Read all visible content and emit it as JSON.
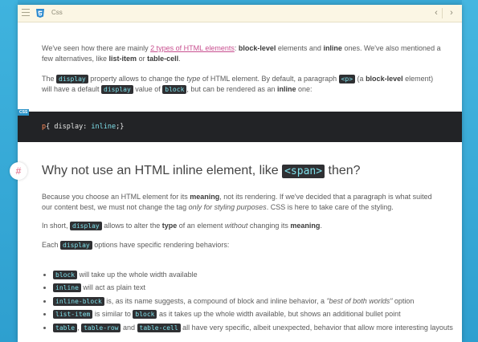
{
  "topbar": {
    "title": "Css"
  },
  "intro": {
    "t1": "We've seen how there are mainly ",
    "link": "2 types of HTML elements",
    "t2": ": ",
    "b1": "block-level",
    "t3": " elements and ",
    "b2": "inline",
    "t4": " ones. We've also mentioned a few alternatives, like ",
    "b3": "list-item",
    "t5": " or ",
    "b4": "table-cell",
    "t6": "."
  },
  "p2": {
    "t1": "The ",
    "c1": "display",
    "t2": " property allows to change the ",
    "e1": "type",
    "t3": " of HTML element. By default, a paragraph ",
    "c2": "<p>",
    "t4": " (a ",
    "b1": "block-level",
    "t5": " element) will have a default ",
    "c3": "display",
    "t6": " value of ",
    "c4": "block",
    "t7": ", but can be rendered as an ",
    "b2": "inline",
    "t8": " one:"
  },
  "code": {
    "tag": "CSS",
    "selector": "p",
    "open": "{ display: ",
    "value": "inline",
    "close": ";}"
  },
  "anchor": "#",
  "heading": {
    "t1": "Why not use an HTML inline element, like ",
    "c1": "<span>",
    "t2": " then?"
  },
  "p3": {
    "t1": "Because you choose an HTML element for its ",
    "b1": "meaning",
    "t2": ", not its rendering. If we've decided that a paragraph is what suited our content best, we must not change the tag ",
    "e1": "only for styling purposes",
    "t3": ". CSS is here to take care of the styling."
  },
  "p4": {
    "t1": "In short, ",
    "c1": "display",
    "t2": " allows to alter the ",
    "b1": "type",
    "t3": " of an element ",
    "e1": "without",
    "t4": " changing its ",
    "b2": "meaning",
    "t5": "."
  },
  "p5": {
    "t1": "Each ",
    "c1": "display",
    "t2": " options have specific rendering behaviors:"
  },
  "list": {
    "i1": {
      "c1": "block",
      "t1": " will take up the whole width available"
    },
    "i2": {
      "c1": "inline",
      "t1": " will act as plain text"
    },
    "i3": {
      "c1": "inline-block",
      "t1": " is, as its name suggests, a compound of block and inline behavior, a ",
      "e1": "\"best of both worlds\"",
      "t2": " option"
    },
    "i4": {
      "c1": "list-item",
      "t1": " is similar to ",
      "c2": "block",
      "t2": " as it takes up the whole width available, but shows an additional bullet point"
    },
    "i5": {
      "c1": "table",
      "t1": ", ",
      "c2": "table-row",
      "t2": " and ",
      "c3": "table-cell",
      "t3": " all have very specific, albeit unexpected, behavior that allow more interesting layouts"
    }
  },
  "colors": {
    "accent": "#3aa9d6",
    "link": "#c84f8f",
    "code_bg": "#2f3033",
    "code_fg": "#7fe0ea",
    "topbar_bg": "#fbf6e4"
  },
  "icons": [
    "menu-icon",
    "css3-icon",
    "chevron-left-icon",
    "chevron-right-icon",
    "hash-anchor-icon"
  ]
}
